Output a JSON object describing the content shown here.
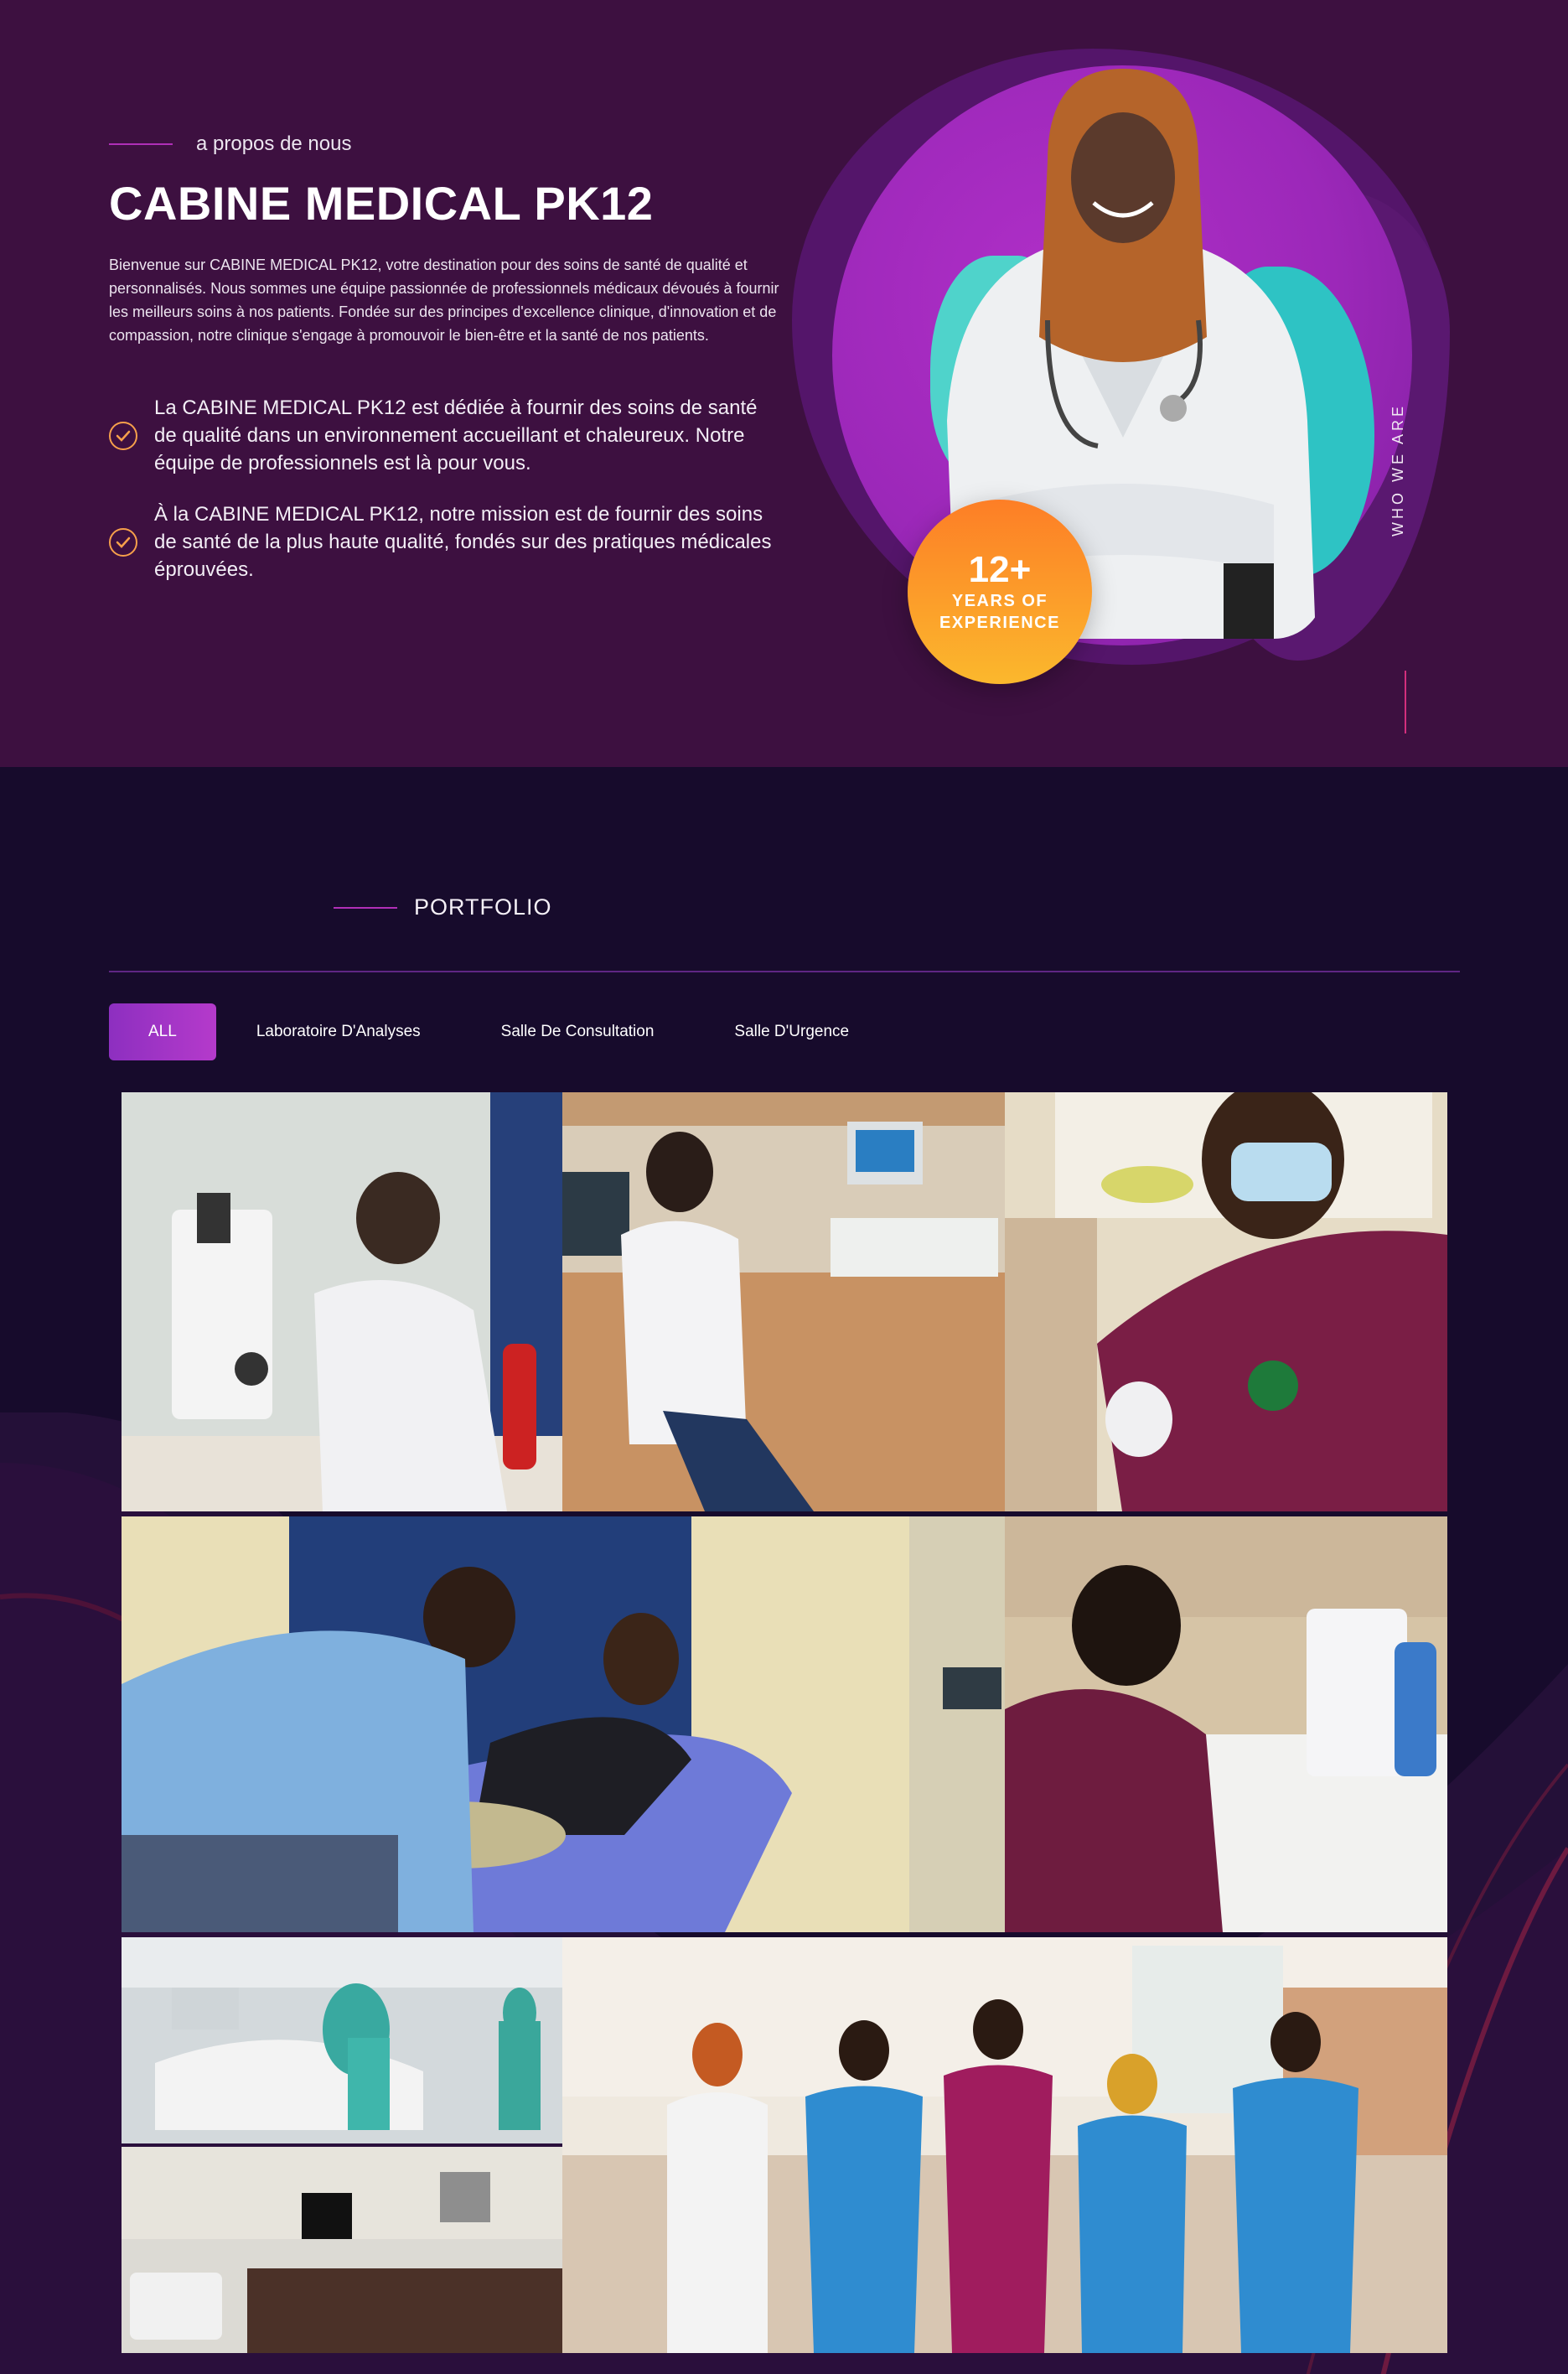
{
  "about": {
    "subheading": "a propos de nous",
    "title": "CABINE MEDICAL PK12",
    "intro": "Bienvenue sur CABINE MEDICAL PK12, votre destination pour des soins de santé de qualité et personnalisés. Nous sommes une équipe passionnée de professionnels médicaux dévoués à fournir les meilleurs soins à nos patients. Fondée sur des principes d'excellence clinique, d'innovation et de compassion, notre clinique s'engage à promouvoir le bien-être et la santé de nos patients.",
    "points": [
      "La CABINE MEDICAL PK12 est dédiée à fournir des soins de santé de qualité dans un environnement accueillant et chaleureux. Notre équipe de professionnels est là pour vous.",
      "À la CABINE MEDICAL PK12, notre mission est de fournir des soins de santé de la plus haute qualité, fondés sur des pratiques médicales éprouvées."
    ],
    "badge_number": "12+",
    "badge_line1": "YEARS OF",
    "badge_line2": "EXPERIENCE",
    "vertical_label": "WHO WE ARE"
  },
  "portfolio": {
    "heading": "PORTFOLIO",
    "tabs": [
      "ALL",
      "Laboratoire D'Analyses",
      "Salle De Consultation",
      "Salle D'Urgence"
    ],
    "active_tab": "ALL"
  },
  "colors": {
    "about_bg": "#3d1040",
    "portfolio_bg": "#170b2c",
    "accent_purple": "#9c28b9",
    "accent_orange": "#fd7e26",
    "accent_teal": "#2ec3c4"
  }
}
